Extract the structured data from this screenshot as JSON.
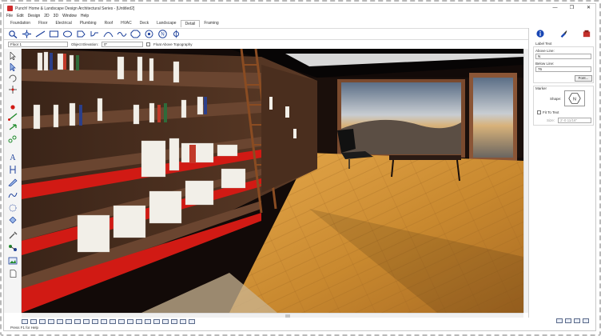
{
  "window": {
    "title": "Punch! Home & Landscape Design Architectural Series - [Untitled2]",
    "controls": [
      "—",
      "❐",
      "✕"
    ]
  },
  "menu": [
    "File",
    "Edit",
    "Design",
    "2D",
    "3D",
    "Window",
    "Help"
  ],
  "mode_tabs": [
    {
      "label": "Foundation",
      "active": false
    },
    {
      "label": "Floor",
      "active": false
    },
    {
      "label": "Electrical",
      "active": false
    },
    {
      "label": "Plumbing",
      "active": false
    },
    {
      "label": "Roof",
      "active": false
    },
    {
      "label": "HVAC",
      "active": false
    },
    {
      "label": "Deck",
      "active": false
    },
    {
      "label": "Landscape",
      "active": false
    },
    {
      "label": "Detail",
      "active": true
    },
    {
      "label": "Framing",
      "active": false
    }
  ],
  "floor_row": {
    "floor_value": "Floor 1",
    "elevation_label": "Object Elevation:",
    "elevation_value": "0\"",
    "float_label": "Float Above Topography"
  },
  "right_panel": {
    "section_title": "Label Text",
    "above_label": "Above Line:",
    "above_value": "N",
    "below_label": "Below Line:",
    "below_value": "76",
    "font_button": "Font...",
    "marker_title": "Marker",
    "shape_label": "Shape:",
    "shape_glyph": "N",
    "fit_label": "Fit To Text",
    "size_label": "Size:",
    "size_value": "2'-0 11/16\""
  },
  "status": {
    "text": "Press F1 for Help"
  },
  "colors": {
    "accent_blue": "#1846b4",
    "shelf_red": "#d11a14",
    "wood_floor": "#c9892f",
    "wall_dark": "#2a1a12"
  }
}
